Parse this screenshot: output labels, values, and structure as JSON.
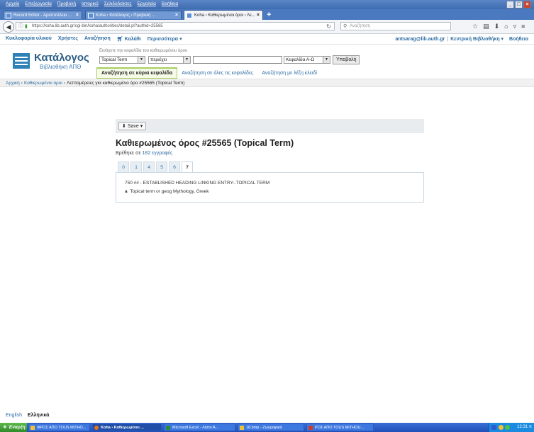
{
  "browser": {
    "menus": [
      "Αρχείο",
      "Επεξεργασία",
      "Προβολή",
      "Ιστορικό",
      "Σελιδοδείκτες",
      "Εργαλεία",
      "Βοήθεια"
    ],
    "tabs": [
      {
        "label": "Record Editor - Αριστοτέλειο ...",
        "active": false
      },
      {
        "label": "Koha › Κατάλογος › Προβολή ...",
        "active": false
      },
      {
        "label": "Koha › Καθιερωμένοι όροι › Λε...",
        "active": true
      }
    ],
    "url": "https://koha.lib.auth.gr/cgi-bin/koha/authorities/detail.pl?authid=25565",
    "search_placeholder": "Αναζήτηση"
  },
  "koha_nav": {
    "items": [
      "Κυκλοφορία υλικού",
      "Χρήστες",
      "Αναζήτηση",
      "Καλάθι",
      "Περισσότερα"
    ],
    "user": "antsarag@lib.auth.gr",
    "library": "Κεντρική Βιβλιοθήκη",
    "help": "Βοήθεια"
  },
  "search": {
    "logo_title": "Κατάλογος",
    "logo_subtitle": "Βιβλιοθήκη ΑΠΘ",
    "hint": "Εισάγετε την κεφαλίδα του καθιερωμένου όρου",
    "auth_type": "Topical Term",
    "operator": "περιέχει",
    "query_value": "",
    "order": "Κεφαλίδα Α-Ω",
    "submit_label": "Υποβολή",
    "tabs": [
      "Αναζήτηση σε κύρια κεφαλίδα",
      "Αναζήτηση σε όλες τις κεφαλίδες",
      "Αναζήτηση με λέξη κλειδί"
    ]
  },
  "breadcrumbs": [
    "Αρχική",
    "Καθιερωμένοι όροι",
    "Λεπτομέρειες για καθιερωμένο όρο #25565 (Topical Term)"
  ],
  "record": {
    "save_label": "Save",
    "title": "Καθιερωμένος όρος #25565 (Topical Term)",
    "used_prefix": "Βρέθηκε σε",
    "used_count_link": "182 εγγραφές",
    "tabs": [
      "0",
      "1",
      "4",
      "5",
      "6",
      "7"
    ],
    "active_tab": "7",
    "field_line": "750 ## - ESTABLISHED HEADING LINKING ENTRY--TOPICAL TERM",
    "subfield_code": "a",
    "subfield_text": "Topical term or geog Mythology, Greek"
  },
  "footer": {
    "lang_en": "English",
    "lang_el": "Ελληνικά"
  },
  "taskbar": {
    "start": "Έναρξη",
    "tasks": [
      "ΦΡΟΣ ΑΠΟ TOUS MITHO...",
      "Koha › Καθιερωμένοι ...",
      "Microsoft Excel - Λίστα Ά...",
      "18.bmp - Ζωγραφική",
      "ΡΟΣ ΑΠΟ TOUS MITHOU..."
    ],
    "active_task": 1,
    "clock": "12:31 π"
  }
}
